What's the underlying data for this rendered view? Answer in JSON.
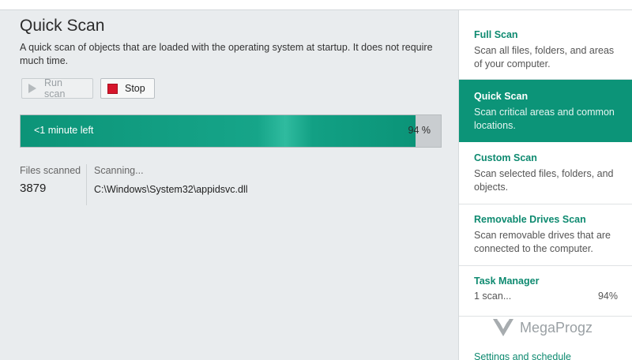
{
  "scan": {
    "title": "Quick Scan",
    "description": "A quick scan of objects that are loaded with the operating system at startup. It does not require much time.",
    "run_label": "Run scan",
    "stop_label": "Stop",
    "time_left": "<1 minute left",
    "progress_pct": 94,
    "progress_text": "94 %",
    "files_label": "Files scanned",
    "files_value": "3879",
    "status_label": "Scanning...",
    "current_file": "C:\\Windows\\System32\\appidsvc.dll"
  },
  "sidebar": {
    "items": [
      {
        "title": "Full Scan",
        "desc": "Scan all files, folders, and areas of your computer."
      },
      {
        "title": "Quick Scan",
        "desc": "Scan critical areas and common locations."
      },
      {
        "title": "Custom Scan",
        "desc": "Scan selected files, folders, and objects."
      },
      {
        "title": "Removable Drives Scan",
        "desc": "Scan removable drives that are connected to the computer."
      }
    ],
    "task_manager": {
      "title": "Task Manager",
      "count": "1 scan...",
      "pct": "94%"
    },
    "settings_link": "Settings and schedule"
  },
  "watermark": {
    "text": "MegaProgz"
  },
  "colors": {
    "accent": "#0c9478",
    "stop": "#d6152b"
  },
  "icons": {
    "run": "play-icon",
    "stop": "stop-icon",
    "watermark": "megaprogz-logo-icon"
  }
}
